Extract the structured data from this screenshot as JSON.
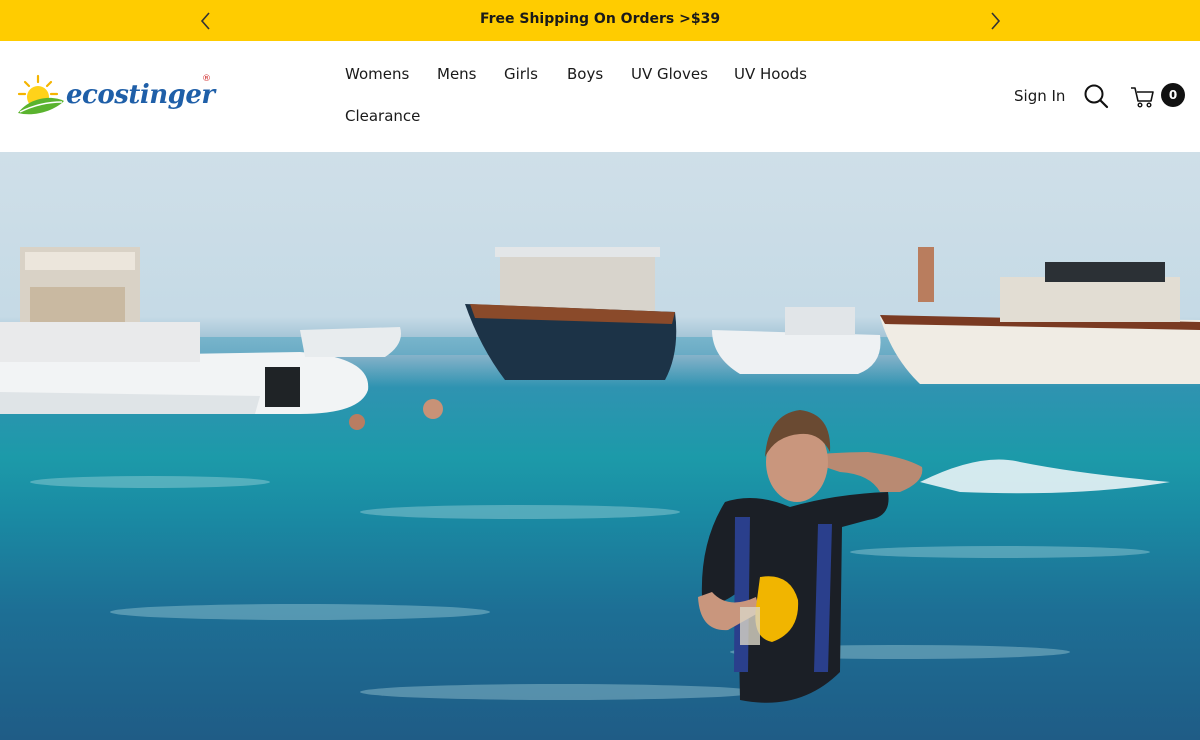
{
  "announcement": {
    "text": "Free Shipping On Orders >$39",
    "prev_icon": "chevron-left-icon",
    "next_icon": "chevron-right-icon",
    "background": "#ffcc00"
  },
  "brand": {
    "name": "ecostinger",
    "mark": "®"
  },
  "nav": {
    "items": [
      {
        "label": "Womens"
      },
      {
        "label": "Mens"
      },
      {
        "label": "Girls"
      },
      {
        "label": "Boys"
      },
      {
        "label": "UV Gloves"
      },
      {
        "label": "UV Hoods"
      },
      {
        "label": "Clearance"
      }
    ]
  },
  "header_actions": {
    "sign_in": "Sign In",
    "search_icon": "search-icon",
    "cart_icon": "cart-icon",
    "cart_count": "0"
  },
  "hero": {
    "image": "photo of a woman in a black swimsuit holding a yellow snorkel mask, standing waist-deep in turquoise sea with boats behind"
  }
}
